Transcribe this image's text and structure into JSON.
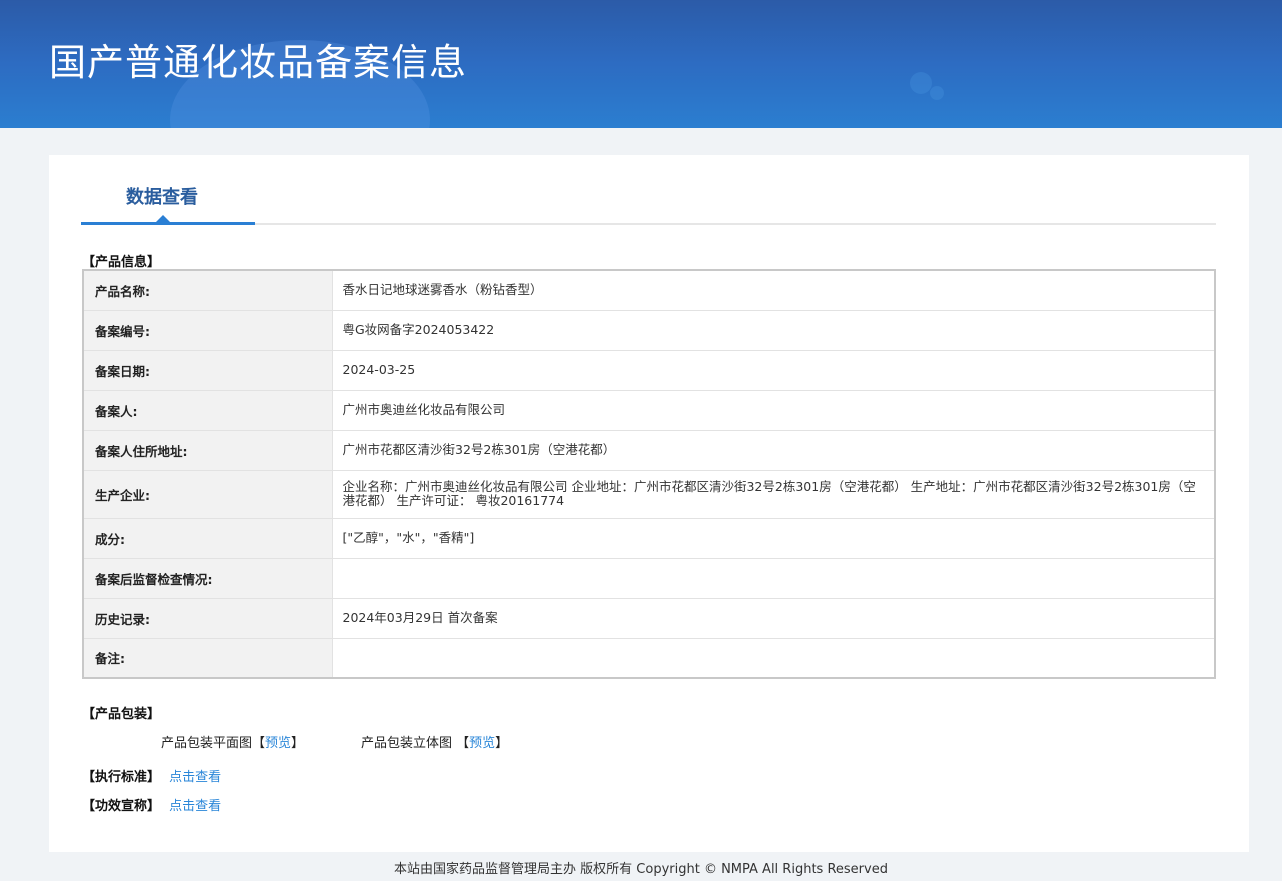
{
  "header": {
    "title": "国产普通化妆品备案信息"
  },
  "tab": {
    "label": "数据查看"
  },
  "product_info": {
    "heading": "【产品信息】",
    "rows": [
      {
        "label": "产品名称:",
        "value": "香水日记地球迷雾香水（粉钻香型）"
      },
      {
        "label": "备案编号:",
        "value": "粤G妆网备字2024053422"
      },
      {
        "label": "备案日期:",
        "value": "2024-03-25"
      },
      {
        "label": "备案人:",
        "value": "广州市奥迪丝化妆品有限公司"
      },
      {
        "label": "备案人住所地址:",
        "value": "广州市花都区清沙街32号2栋301房（空港花都）"
      },
      {
        "label": "生产企业:",
        "value": "企业名称：广州市奥迪丝化妆品有限公司 企业地址：广州市花都区清沙街32号2栋301房（空港花都） 生产地址：广州市花都区清沙街32号2栋301房（空港花都） 生产许可证： 粤妆20161774"
      },
      {
        "label": "成分:",
        "value": "[\"乙醇\"，\"水\"，\"香精\"]"
      },
      {
        "label": "备案后监督检查情况:",
        "value": ""
      },
      {
        "label": "历史记录:",
        "value": "2024年03月29日 首次备案"
      },
      {
        "label": "备注:",
        "value": ""
      }
    ]
  },
  "packaging": {
    "heading": "【产品包装】",
    "flat_label": "产品包装平面图",
    "stereo_label": "产品包装立体图 ",
    "bracket_open": "【",
    "bracket_close": "】",
    "preview": "预览"
  },
  "standard": {
    "heading": "【执行标准】",
    "link": "点击查看"
  },
  "efficacy": {
    "heading": "【功效宣称】",
    "link": "点击查看"
  },
  "footer": {
    "text": "本站由国家药品监督管理局主办 版权所有 Copyright © NMPA All Rights Reserved"
  }
}
